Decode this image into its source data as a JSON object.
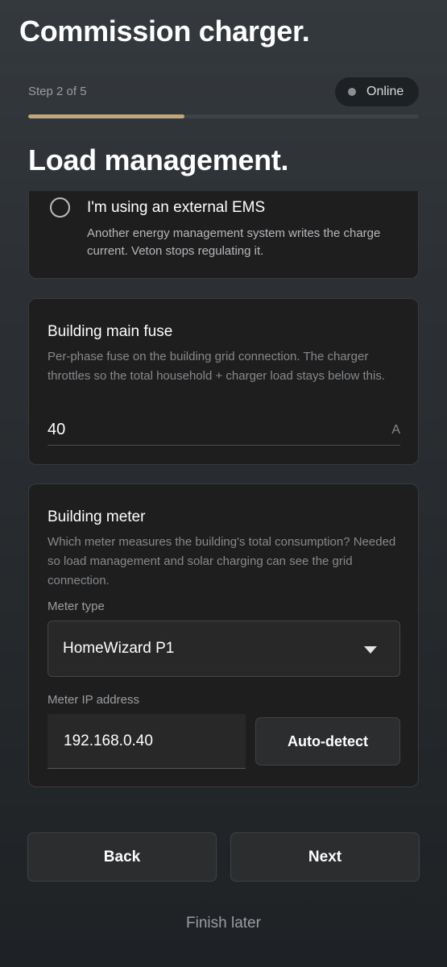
{
  "app": {
    "title": "Commission charger."
  },
  "progress": {
    "step_label": "Step 2 of 5",
    "current_step": 2,
    "total_steps": 5,
    "fill_fraction": 0.4,
    "fill_color": "#bfa77b"
  },
  "status": {
    "label": "Online",
    "dot_icon": "status-dot-icon"
  },
  "section": {
    "title": "Load management."
  },
  "ems_option": {
    "title": "I'm using an external EMS",
    "description": "Another energy management system writes the charge current. Veton stops regulating it.",
    "selected": false
  },
  "fuse": {
    "title": "Building main fuse",
    "description": "Per-phase fuse on the building grid connection. The charger throttles so the total household + charger load stays below this.",
    "value": "40",
    "unit": "A"
  },
  "meter": {
    "title": "Building meter",
    "description": "Which meter measures the building's total consumption? Needed so load management and solar charging can see the grid connection.",
    "type_label": "Meter type",
    "type_value": "HomeWizard P1",
    "ip_label": "Meter IP address",
    "ip_value": "192.168.0.40",
    "detect_label": "Auto-detect"
  },
  "nav": {
    "back_label": "Back",
    "next_label": "Next",
    "finish_later_label": "Finish later"
  }
}
